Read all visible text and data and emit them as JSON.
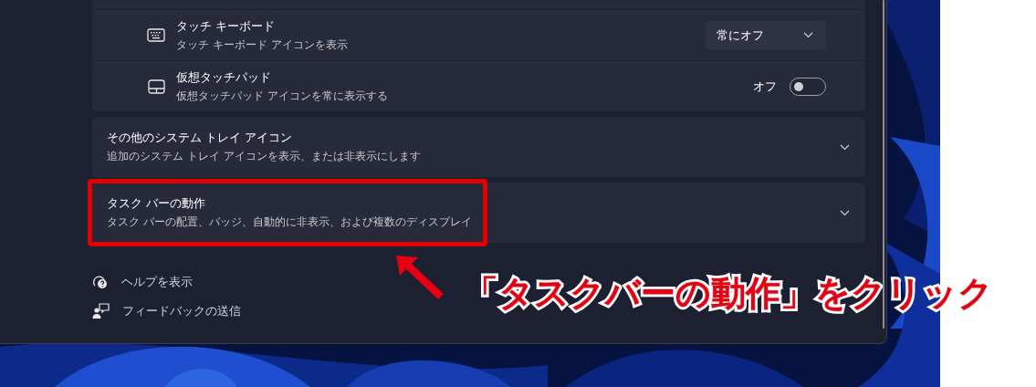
{
  "settings": {
    "group_rows": [
      {
        "kind": "dropdown",
        "title": "タッチ キーボード",
        "description": "タッチ キーボード アイコンを表示",
        "value": "常にオフ"
      },
      {
        "kind": "toggle",
        "title": "仮想タッチパッド",
        "description": "仮想タッチパッド アイコンを常に表示する",
        "state_label": "オフ",
        "on": false
      }
    ],
    "expanders": [
      {
        "title": "その他のシステム トレイ アイコン",
        "description": "追加のシステム トレイ アイコンを表示、または非表示にします",
        "expanded": false,
        "highlighted": false
      },
      {
        "title": "タスク バーの動作",
        "description": "タスク バーの配置、バッジ、自動的に非表示、および複数のディスプレイ",
        "expanded": false,
        "highlighted": true
      }
    ]
  },
  "links": [
    {
      "label": "ヘルプを表示"
    },
    {
      "label": "フィードバックの送信"
    }
  ],
  "annotation": {
    "text": "「タスクバーの動作」をクリック"
  }
}
